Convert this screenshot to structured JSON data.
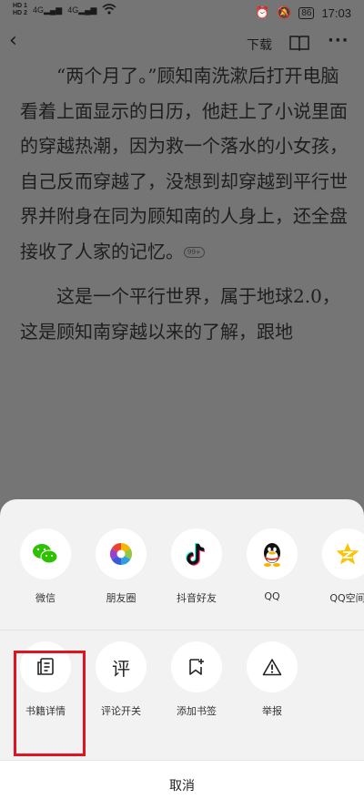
{
  "status_bar": {
    "sim1": "HD 1",
    "sim2": "HD 2",
    "net1": "4G",
    "net2": "4G",
    "battery": "86",
    "time": "17:03"
  },
  "toolbar": {
    "download_label": "下载"
  },
  "reader": {
    "paragraphs": [
      "“两个月了。”顾知南洗漱后打开电脑看着上面显示的日历，他赶上了小说里面的穿越热潮，因为救一个落水的小女孩，自己反而穿越了，没想到却穿越到平行世界并附身在同为顾知南的人身上，还全盘接收了人家的记忆。",
      "这是一个平行世界，属于地球2.0，这是顾知南穿越以来的了解，跟地"
    ],
    "comment_badge": "99+"
  },
  "share_sheet": {
    "share_targets": [
      {
        "label": "微信",
        "icon": "wechat-icon"
      },
      {
        "label": "朋友圈",
        "icon": "moments-icon"
      },
      {
        "label": "抖音好友",
        "icon": "douyin-icon"
      },
      {
        "label": "QQ",
        "icon": "qq-icon"
      },
      {
        "label": "QQ空间",
        "icon": "qzone-icon"
      }
    ],
    "actions": [
      {
        "label": "书籍详情",
        "icon": "book-details-icon"
      },
      {
        "label": "评论开关",
        "icon": "comment-toggle-icon"
      },
      {
        "label": "添加书签",
        "icon": "bookmark-add-icon"
      },
      {
        "label": "举报",
        "icon": "report-icon"
      }
    ],
    "cancel_label": "取消"
  },
  "colors": {
    "highlight_border": "#e0141e",
    "sheet_background": "#f2f2f2",
    "overlay": "#757575"
  }
}
